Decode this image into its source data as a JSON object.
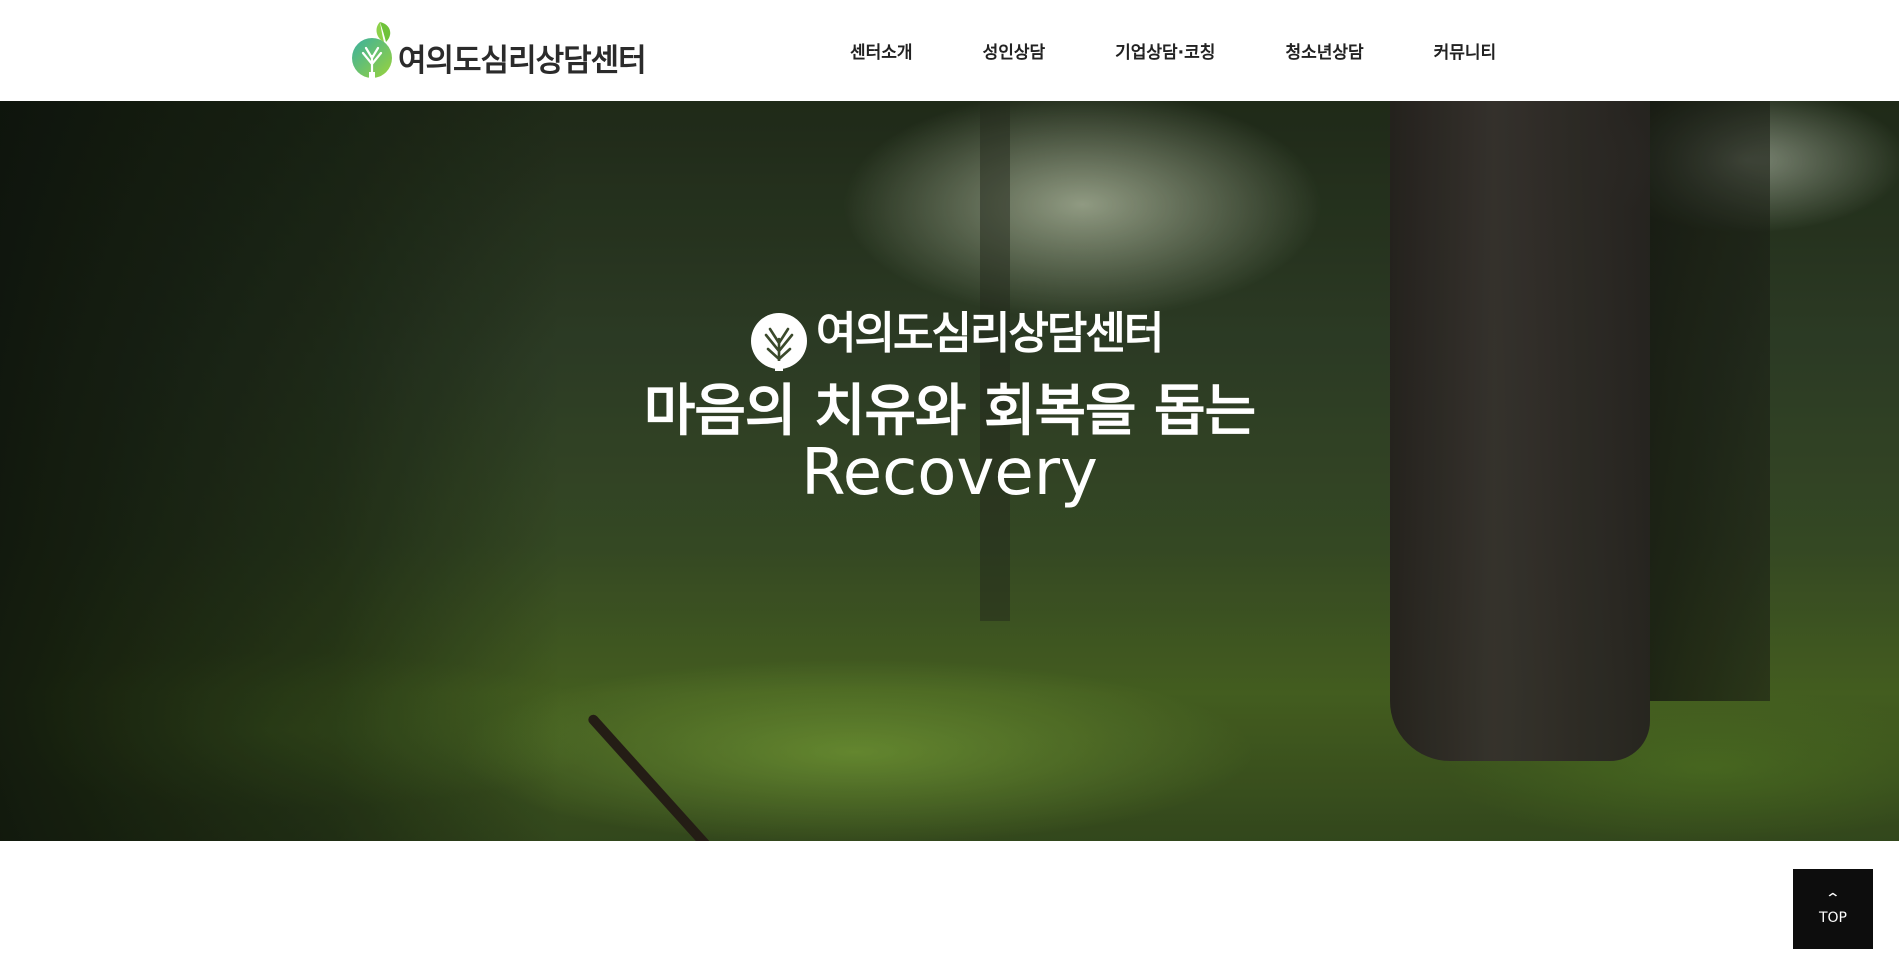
{
  "header": {
    "logo": {
      "text": "여의도심리상담센터",
      "icon": "tree-leaf-logo-icon",
      "colors": {
        "leaf_green": "#6fc23a",
        "tree_teal": "#3ab0a0",
        "tree_green": "#8dc63f",
        "text": "#2b2b2b"
      }
    },
    "nav": [
      {
        "label": "센터소개"
      },
      {
        "label": "성인상담"
      },
      {
        "label": "기업상담·코칭"
      },
      {
        "label": "청소년상담"
      },
      {
        "label": "커뮤니티"
      }
    ]
  },
  "hero": {
    "brand_text": "여의도심리상담센터",
    "brand_icon": "tree-leaf-logo-icon",
    "tagline": "마음의 치유와 회복을 돕는",
    "headline": "Recovery",
    "background": "forest-photo"
  },
  "top_button": {
    "icon": "chevron-up-icon",
    "label": "TOP"
  }
}
